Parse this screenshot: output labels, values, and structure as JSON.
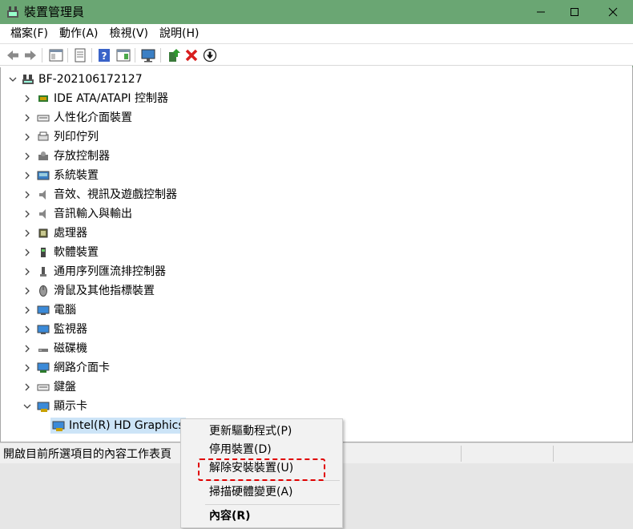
{
  "window": {
    "title": "裝置管理員",
    "minimize_glyph": "—",
    "maximize_glyph": "☐",
    "close_glyph": "✕"
  },
  "menu": [
    "檔案(F)",
    "動作(A)",
    "檢視(V)",
    "說明(H)"
  ],
  "toolbar": {
    "buttons": [
      "back-arrow-icon",
      "forward-arrow-icon",
      "show-hide-console-tree-icon",
      "properties-icon",
      "help-icon",
      "action-pane-icon",
      "scan-monitor-icon",
      "update-driver-icon",
      "uninstall-x-icon",
      "disable-down-arrow-icon"
    ]
  },
  "tree": {
    "root": "BF-202106172127",
    "categories": [
      "IDE ATA/ATAPI 控制器",
      "人性化介面裝置",
      "列印佇列",
      "存放控制器",
      "系統裝置",
      "音效、視訊及遊戲控制器",
      "音訊輸入與輸出",
      "處理器",
      "軟體裝置",
      "通用序列匯流排控制器",
      "滑鼠及其他指標裝置",
      "電腦",
      "監視器",
      "磁碟機",
      "網路介面卡",
      "鍵盤",
      "顯示卡"
    ],
    "expanded_child": "Intel(R) HD Graphics"
  },
  "status": {
    "text": "開啟目前所選項目的內容工作表頁"
  },
  "context_menu": {
    "items": [
      "更新驅動程式(P)",
      "停用裝置(D)",
      "解除安裝裝置(U)",
      "掃描硬體變更(A)",
      "內容(R)"
    ]
  },
  "colors": {
    "titlebar": "#6aa673",
    "selection": "#cce4f7",
    "highlight_box": "#e00000"
  }
}
